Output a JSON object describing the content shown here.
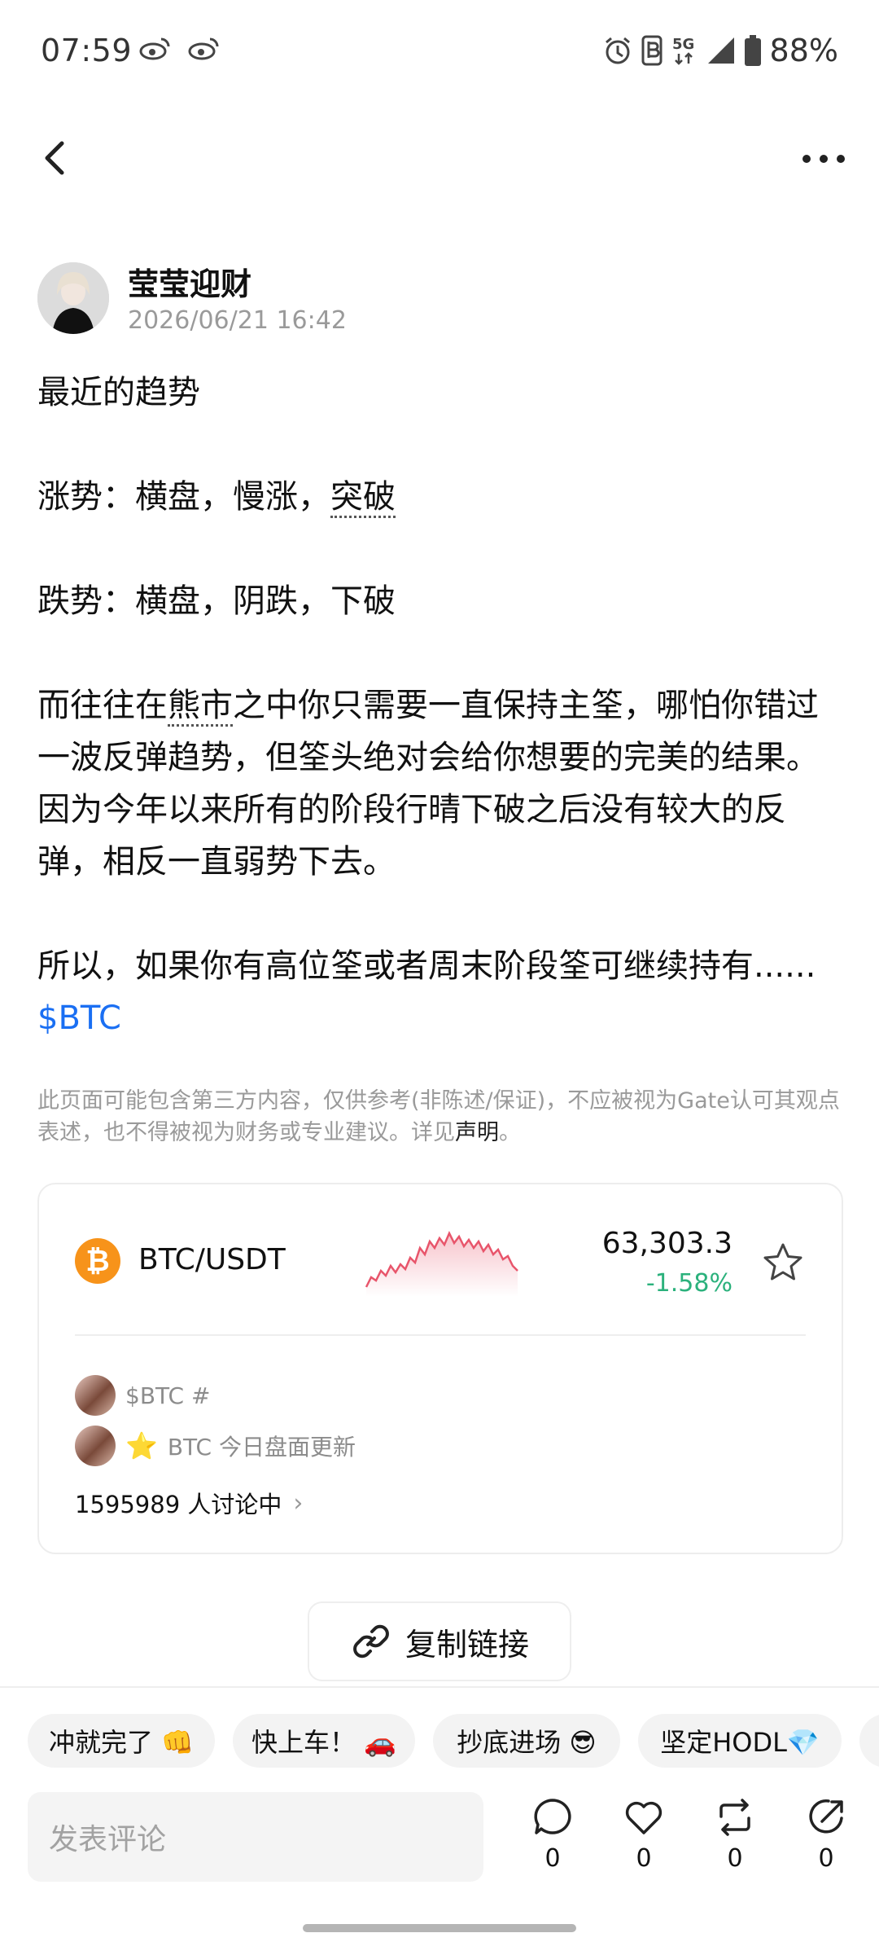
{
  "status_bar": {
    "time": "07:59",
    "network": "5G",
    "battery": "88%",
    "icons": [
      "weibo-icon",
      "weibo-icon",
      "alarm-icon",
      "nfc-icon",
      "signal-icon",
      "battery-icon"
    ]
  },
  "nav": {
    "back_icon": "chevron-left-icon",
    "more_icon": "more-horizontal-icon"
  },
  "post": {
    "author": "莹莹迎财",
    "time": "2026/06/21 16:42",
    "line1": "最近的趋势",
    "line2_prefix": "涨势：横盘，慢涨，",
    "line2_dotted": "突破",
    "line3": "跌势：横盘，阴跌，下破",
    "para_prefix": "而往往在",
    "para_dotted": "熊市",
    "para_rest": "之中你只需要一直保持主筌，哪怕你错过一波反弹趋势，但筌头绝对会给你想要的完美的结果。因为今年以来所有的阶段行晴下破之后没有较大的反弹，相反一直弱势下去。",
    "last_para": "所以，如果你有高位筌或者周末阶段筌可继续持有......",
    "cashtag": "$BTC"
  },
  "disclaimer": {
    "text": "此页面可能包含第三方内容，仅供参考(非陈述/保证)，不应被视为Gate认可其观点表述，也不得被视为财务或专业建议。详见",
    "link": "声明",
    "end": "。"
  },
  "market_card": {
    "coin_symbol": "₿",
    "pair": "BTC/USDT",
    "price": "63,303.3",
    "change": "-1.58%",
    "change_color": "#2bb17c",
    "sparkline_color": "#e8556b",
    "star_icon": "star-outline-icon",
    "topic1": "$BTC #",
    "topic2_star": "⭐",
    "topic2": "BTC 今日盘面更新",
    "discuss_count": "1595989 人讨论中",
    "discuss_chevron": "›"
  },
  "copy_link": {
    "icon": "link-icon",
    "label": "复制链接"
  },
  "chips": [
    "冲就完了 👊",
    "快上车！ 🚗",
    "抄底进场 😎",
    "坚定HODL💎"
  ],
  "comment_bar": {
    "placeholder": "发表评论",
    "actions": [
      {
        "icon": "comment-icon",
        "count": "0"
      },
      {
        "icon": "heart-icon",
        "count": "0"
      },
      {
        "icon": "repost-icon",
        "count": "0"
      },
      {
        "icon": "share-icon",
        "count": "0"
      }
    ]
  }
}
